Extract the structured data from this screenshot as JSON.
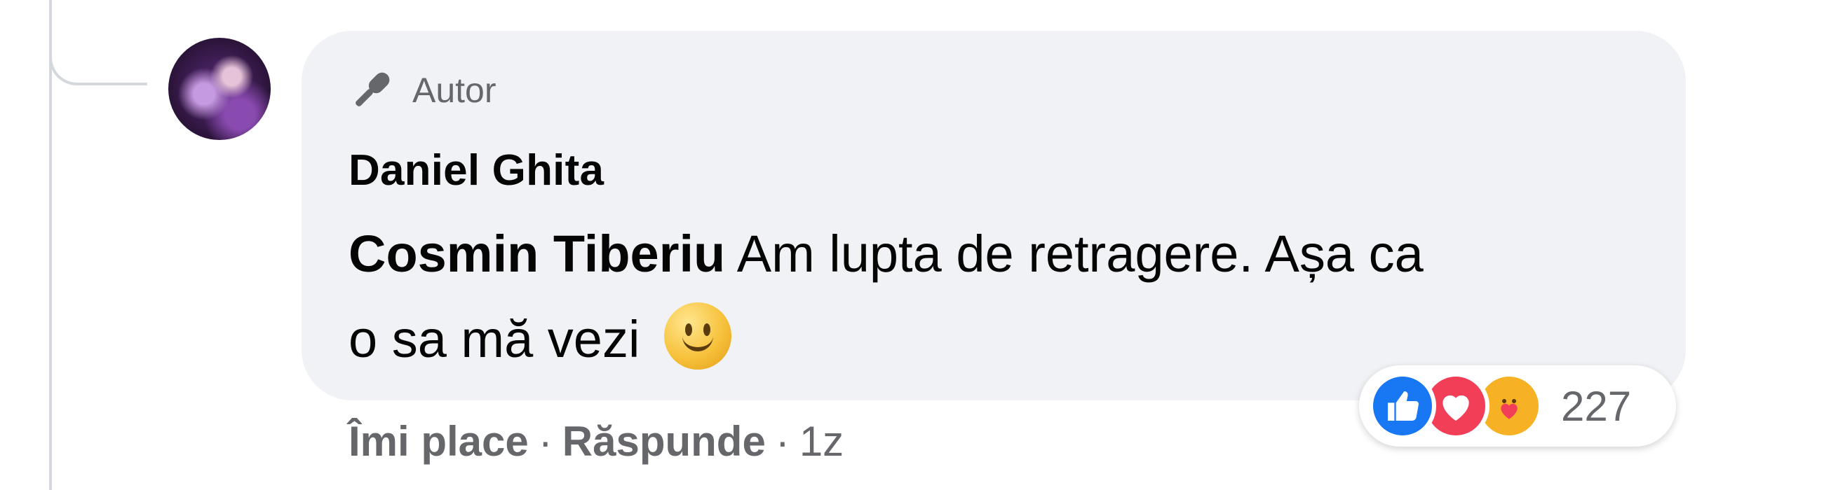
{
  "comment": {
    "badge_label": "Autor",
    "author_name": "Daniel Ghita",
    "mention": "Cosmin Tiberiu",
    "message_line1_rest": " Am lupta de retragere. Așa ca",
    "message_line2": "o sa mă vezi",
    "emoji": "slightly-smiling-face-icon"
  },
  "actions": {
    "like_label": "Îmi place",
    "separator": "·",
    "reply_label": "Răspunde",
    "time": "1z"
  },
  "reactions": {
    "icons": [
      "like-icon",
      "love-icon",
      "care-icon"
    ],
    "count": "227"
  },
  "colors": {
    "bubble": "#f0f2f5",
    "secondary_text": "#65676b",
    "like": "#1877f2",
    "love": "#f33e58",
    "care": "#f7b125"
  }
}
